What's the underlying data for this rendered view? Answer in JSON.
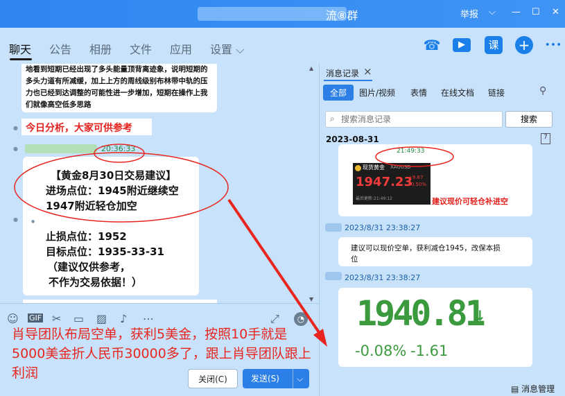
{
  "window": {
    "title": "流⑧群",
    "report": "举报",
    "min": "—",
    "max": "☐",
    "close": "✕"
  },
  "nav": {
    "tabs": [
      "聊天",
      "公告",
      "相册",
      "文件",
      "应用",
      "设置 ⌵"
    ]
  },
  "toolbar": {
    "call": "☎",
    "video": "▶",
    "lesson": "课",
    "add": "+",
    "more": "•••"
  },
  "chat": {
    "prev_message": [
      "地看到短期已经出现了多头能量顶背离迹象，说明短期的",
      "多头力道有所减缓，加上上方的周线级别布林带中轨的压",
      "力也已经到达调整的可能性进一步增加，短期在操作上我",
      "们就像高空低多思路"
    ],
    "highlight": "今日分析，大家可供参考",
    "time": "20:36:33",
    "analysis": [
      "【黄金8月30日交易建议】",
      "进场点位：1945附近继续空",
      "1947附近轻仓加空",
      "止损点位：1952",
      "目标点位：1935-33-31",
      "（建议仅供参考，",
      "不作为交易依据！）"
    ]
  },
  "composer": {
    "gif": "GIF",
    "close_btn": "关闭(C)",
    "send_btn": "发送(S)",
    "send_arrow": "⌵"
  },
  "overlay": "肖导团队布局空单，获利5美金，按照10手就是5000美金折人民币30000多了，跟上肖导团队跟上利润",
  "history": {
    "tab": "消息记录",
    "tab_close": "×",
    "filters": [
      "全部",
      "图片/视频",
      "表情",
      "在线文档",
      "链接"
    ],
    "search_placeholder": "搜索消息记录",
    "search_btn": "搜索",
    "date": "2023-08-31",
    "cal_icon": "7",
    "msg1_time": "21:49:33",
    "quote": {
      "label": "现货黄金",
      "code": "XAUUSD",
      "price": "1947.23",
      "chg1": "+9.67",
      "chg2": "+0.50%",
      "updated": "最后更新:21:49:12"
    },
    "msg1_note": "建议现价可轻仓补进空",
    "ts2": "2023/8/31 23:38:27",
    "msg2": [
      "建议可以现价空单，获利减仓1945，改保本损",
      "位"
    ],
    "ts3": "2023/8/31 23:38:27",
    "big_price": "1940.81",
    "big_arrow": "↓",
    "big_pct": "-0.08%",
    "big_chg": "-1.61",
    "manage": "消息管理"
  }
}
